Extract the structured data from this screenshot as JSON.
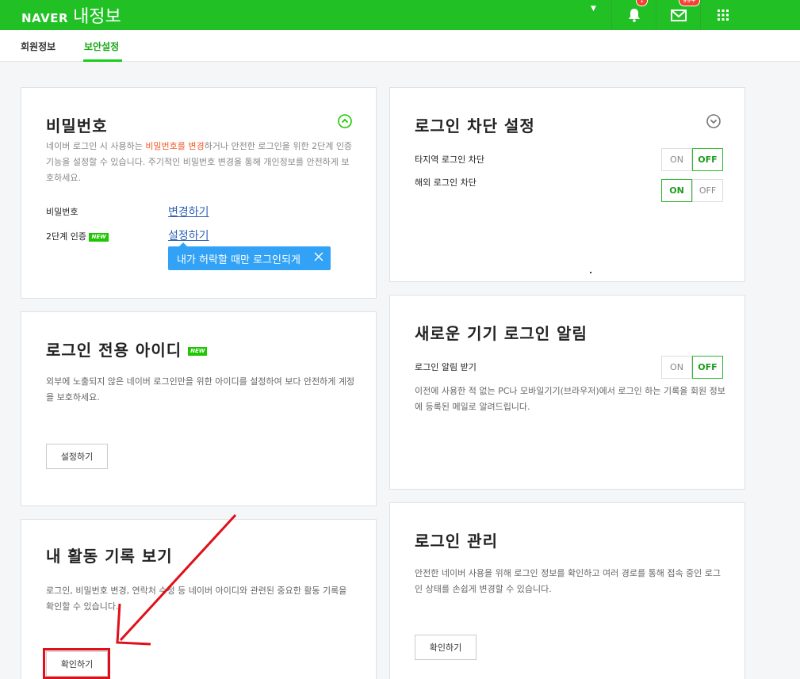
{
  "header": {
    "brand": "NAVER",
    "title": "내정보",
    "caret": "▼",
    "notification_count": "1",
    "mail_count": "99+"
  },
  "tabs": [
    {
      "label": "회원정보"
    },
    {
      "label": "보안설정"
    }
  ],
  "password_card": {
    "title": "비밀번호",
    "desc_pre": "네이버 로그인 시 사용하는 ",
    "desc_highlight": "비밀번호를 변경",
    "desc_post": "하거나 안전한 로그인을 위한 2단계 인증 기능을 설정할 수 있습니다. 주기적인 비밀번호 변경을 통해 개인정보를 안전하게 보호하세요.",
    "row1_label": "비밀번호",
    "row1_link": "변경하기",
    "row2_label": "2단계 인증",
    "row2_badge": "NEW",
    "row2_link": "설정하기",
    "tooltip": "내가 허락할 때만 로그인되게"
  },
  "login_only_id_card": {
    "title": "로그인 전용 아이디",
    "badge": "NEW",
    "desc": "외부에 노출되지 않은 네이버 로그인만을 위한 아이디를 설정하여 보다 안전하게 계정을 보호하세요.",
    "button": "설정하기"
  },
  "activity_card": {
    "title": "내 활동 기록 보기",
    "desc": "로그인, 비밀번호 변경, 연락처 수정 등 네이버 아이디와 관련된 중요한 활동 기록을 확인할 수 있습니다.",
    "button": "확인하기"
  },
  "login_block_card": {
    "title": "로그인 차단 설정",
    "row1_label": "타지역 로그인 차단",
    "row1_on": "ON",
    "row1_off": "OFF",
    "row2_label": "해외 로그인 차단",
    "row2_on": "ON",
    "row2_off": "OFF"
  },
  "new_device_card": {
    "title": "새로운 기기 로그인 알림",
    "row_label": "로그인 알림 받기",
    "on": "ON",
    "off": "OFF",
    "desc": "이전에 사용한 적 없는 PC나 모바일기기(브라우저)에서 로그인 하는 기록을 회원 정보에 등록된 메일로 알려드립니다."
  },
  "login_manage_card": {
    "title": "로그인 관리",
    "desc": "안전한 네이버 사용을 위해 로그인 정보를 확인하고 여러 경로를 통해 접속 중인 로그인 상태를 손쉽게 변경할 수 있습니다.",
    "button": "확인하기"
  },
  "toggle_states": {
    "other_region_block": "OFF",
    "overseas_block": "ON",
    "new_device_alert": "OFF"
  },
  "colors": {
    "header_green": "#21c125",
    "annotation_red": "#e0101a",
    "tooltip_blue": "#31a2f5",
    "highlight_orange": "#f25a27"
  }
}
